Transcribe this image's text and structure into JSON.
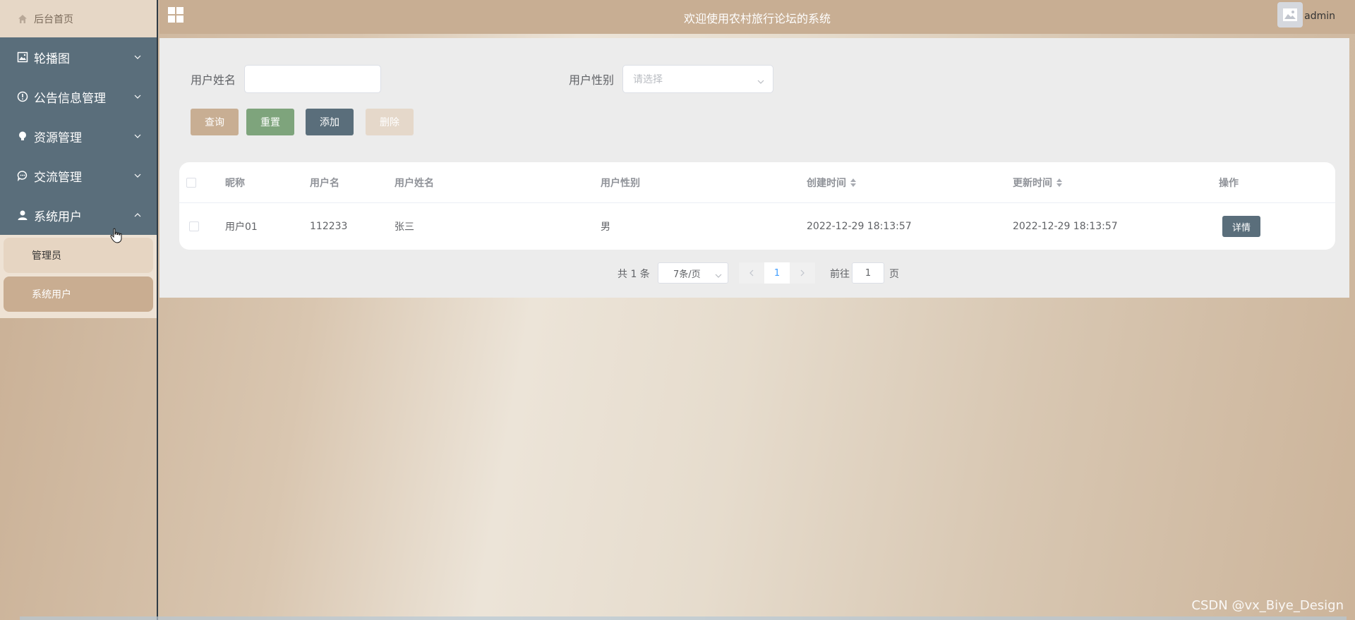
{
  "sidebar": {
    "home": "后台首页",
    "menu": [
      {
        "label": "轮播图",
        "icon": "picture-icon"
      },
      {
        "label": "公告信息管理",
        "icon": "info-circle-icon"
      },
      {
        "label": "资源管理",
        "icon": "bulb-icon"
      },
      {
        "label": "交流管理",
        "icon": "chat-icon"
      },
      {
        "label": "系统用户",
        "icon": "user-icon"
      }
    ],
    "submenu": [
      {
        "label": "管理员"
      },
      {
        "label": "系统用户"
      }
    ]
  },
  "header": {
    "title": "欢迎使用农村旅行论坛的系统",
    "username": "admin"
  },
  "filters": {
    "name_label": "用户姓名",
    "name_value": "",
    "gender_label": "用户性别",
    "gender_placeholder": "请选择"
  },
  "actions": {
    "query": "查询",
    "reset": "重置",
    "add": "添加",
    "delete": "删除"
  },
  "table": {
    "columns": [
      "昵称",
      "用户名",
      "用户姓名",
      "用户性别",
      "创建时间",
      "更新时间",
      "操作"
    ],
    "rows": [
      {
        "nickname": "用户01",
        "username": "112233",
        "realname": "张三",
        "gender": "男",
        "created": "2022-12-29 18:13:57",
        "updated": "2022-12-29 18:13:57",
        "action": "详情"
      }
    ]
  },
  "pagination": {
    "total": "共 1 条",
    "page_size": "7条/页",
    "current": "1",
    "goto_label": "前往",
    "goto_value": "1",
    "page_suffix": "页"
  },
  "watermark": "CSDN @vx_Biye_Design",
  "colors": {
    "brand": "#c8ae93",
    "sidebar": "#5a6e7b",
    "reset": "#7ea47c",
    "link": "#409eff"
  }
}
